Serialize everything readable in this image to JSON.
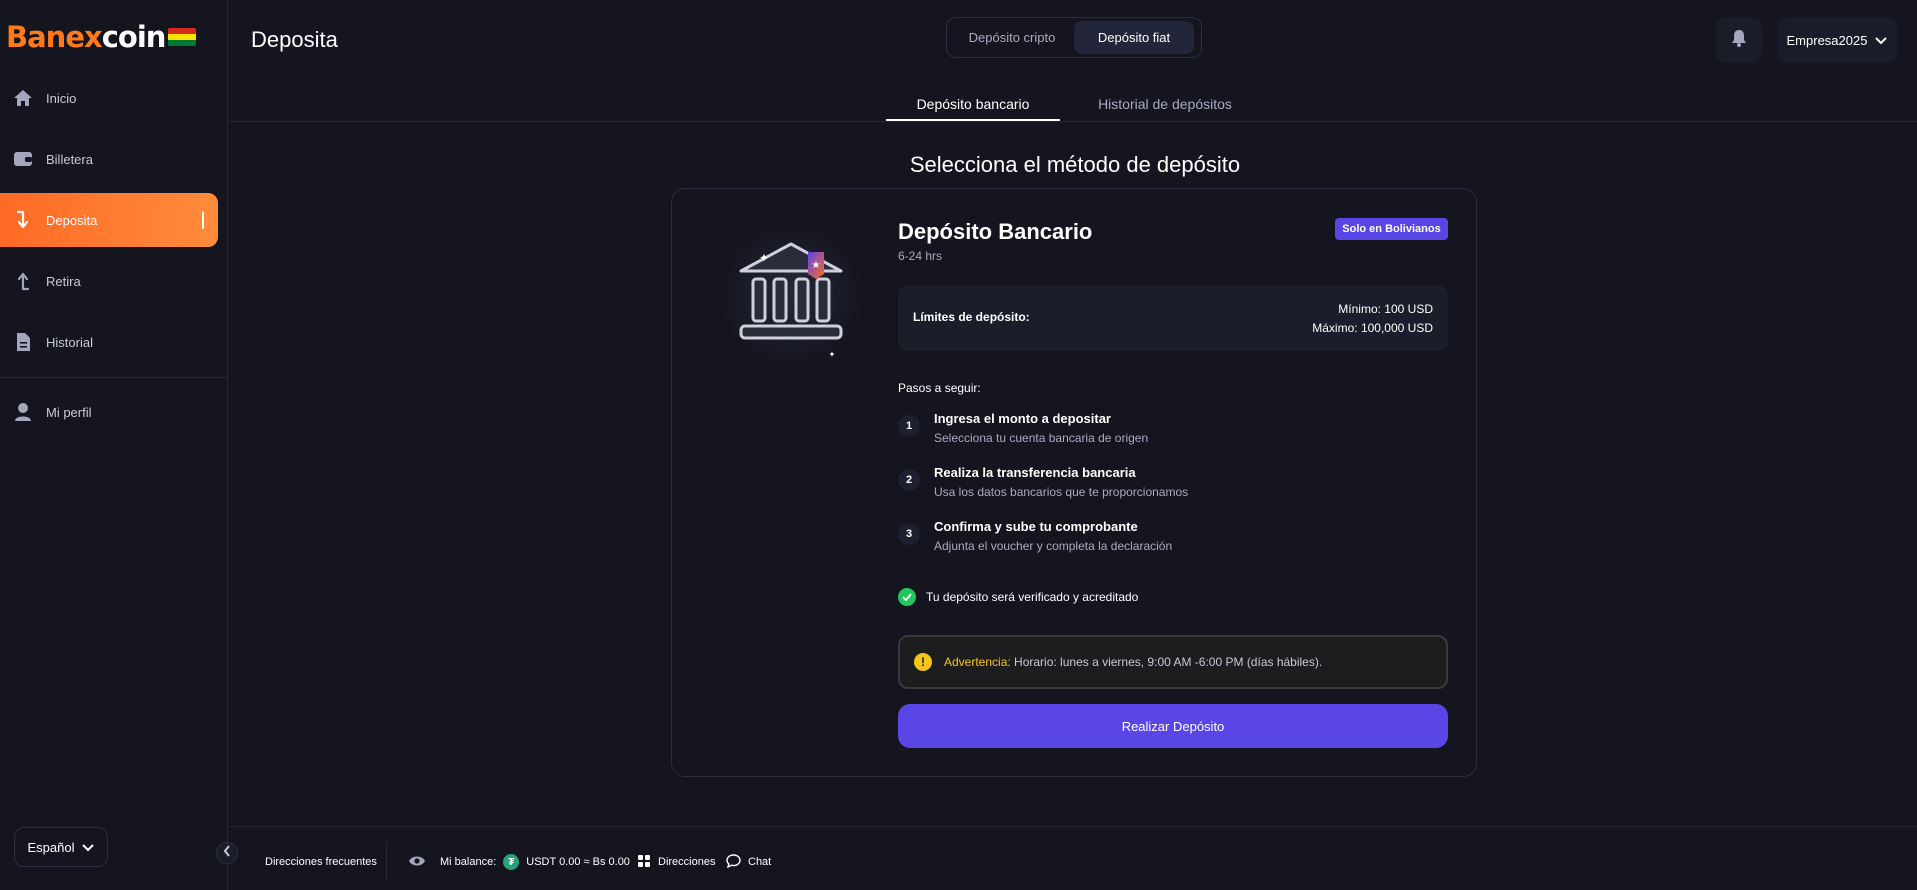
{
  "brand": {
    "part1": "Ban",
    "part2": "ex",
    "part3": "coin"
  },
  "sidebar": {
    "items": [
      {
        "label": "Inicio"
      },
      {
        "label": "Billetera"
      },
      {
        "label": "Deposita"
      },
      {
        "label": "Retira"
      },
      {
        "label": "Historial"
      },
      {
        "label": "Mi perfil"
      }
    ],
    "language": "Español"
  },
  "header": {
    "title": "Deposita",
    "segments": [
      "Depósito cripto",
      "Depósito fiat"
    ],
    "active_segment": "Depósito fiat",
    "user": "Empresa2025"
  },
  "tabs": [
    {
      "label": "Depósito bancario"
    },
    {
      "label": "Historial de depósitos"
    }
  ],
  "main": {
    "title": "Selecciona el método de depósito",
    "method": {
      "title": "Depósito Bancario",
      "time": "6-24 hrs",
      "badge": "Solo en Bolivianos",
      "limits_label": "Límites de depósito:",
      "min": "Mínimo: 100 USD",
      "max": "Máximo: 100,000 USD",
      "steps_label": "Pasos a seguir:",
      "steps": [
        {
          "num": "1",
          "title": "Ingresa el monto a depositar",
          "desc": "Selecciona tu cuenta bancaria de origen"
        },
        {
          "num": "2",
          "title": "Realiza la transferencia bancaria",
          "desc": "Usa los datos bancarios que te proporcionamos"
        },
        {
          "num": "3",
          "title": "Confirma y sube tu comprobante",
          "desc": "Adjunta el voucher y completa la declaración"
        }
      ],
      "verify_text": "Tu depósito será verificado y acreditado",
      "warning_label": "Advertencia:",
      "warning_text": " Horario: lunes a viernes, 9:00 AM -6:00 PM (días hábiles).",
      "cta": "Realizar Depósito"
    }
  },
  "footer": {
    "frequent": "Direcciones frecuentes",
    "balance_label": "Mi balance:",
    "balance_value": "USDT 0.00 ≈ Bs 0.00",
    "addresses": "Direcciones",
    "chat": "Chat"
  },
  "colors": {
    "accent": "#ff7a1a",
    "primary": "#5a45e6",
    "bg": "#14151f",
    "warning": "#f5c518",
    "success": "#22c55e"
  }
}
